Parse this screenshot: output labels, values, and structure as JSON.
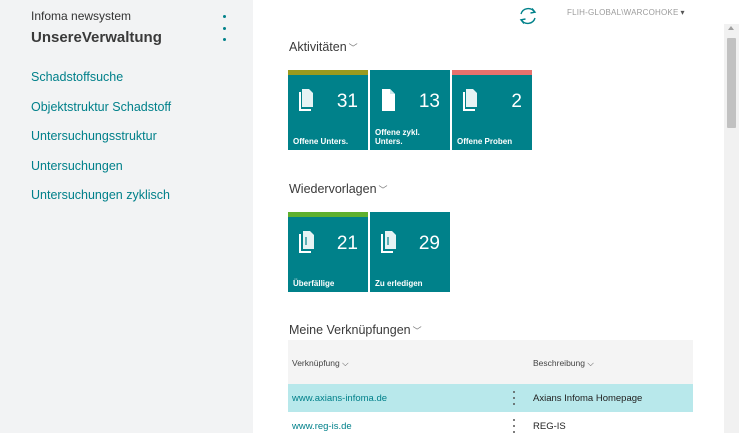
{
  "sidebar": {
    "app_name": "Infoma newsystem",
    "company": "UnsereVerwaltung",
    "items": [
      {
        "label": "Schadstoffsuche"
      },
      {
        "label": "Objektstruktur Schadstoff"
      },
      {
        "label": "Untersuchungsstruktur"
      },
      {
        "label": "Untersuchungen"
      },
      {
        "label": "Untersuchungen zyklisch"
      }
    ]
  },
  "header": {
    "user": "FLIH-GLOBAL\\WARCOHOKE",
    "refresh_icon": "refresh-icon"
  },
  "activities": {
    "title": "Aktivitäten",
    "tiles": [
      {
        "count": "31",
        "label": "Offene Unters.",
        "strip_color": "#9b9a1e"
      },
      {
        "count": "13",
        "label": "Offene zykl. Unters.",
        "strip_color": ""
      },
      {
        "count": "2",
        "label": "Offene Proben",
        "strip_color": "#e8716d"
      }
    ]
  },
  "followups": {
    "title": "Wiedervorlagen",
    "tiles": [
      {
        "count": "21",
        "label": "Überfällige",
        "strip_color": "#5fb02e"
      },
      {
        "count": "29",
        "label": "Zu erledigen",
        "strip_color": ""
      }
    ]
  },
  "shortcuts": {
    "title": "Meine Verknüpfungen",
    "columns": {
      "link": "Verknüpfung",
      "desc": "Beschreibung"
    },
    "rows": [
      {
        "link": "www.axians-infoma.de",
        "desc": "Axians Infoma Homepage",
        "selected": true
      },
      {
        "link": "www.reg-is.de",
        "desc": "REG-IS",
        "selected": false
      }
    ]
  },
  "colors": {
    "accent": "#00818a",
    "sidebar_bg": "#f2f3f4",
    "selection": "#b8e8eb"
  }
}
